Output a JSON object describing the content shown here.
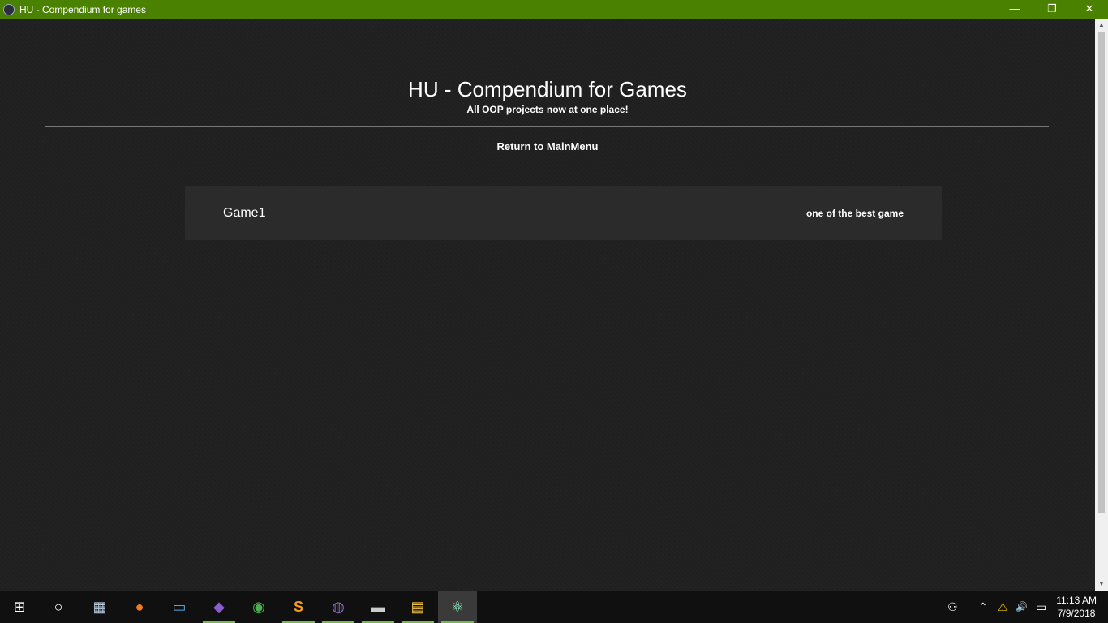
{
  "window": {
    "title": "HU - Compendium for games",
    "minimize": "—",
    "restore": "❐",
    "close": "✕"
  },
  "page": {
    "title": "HU - Compendium for Games",
    "subtitle": "All OOP projects now at one place!",
    "return_link": "Return to MainMenu"
  },
  "games": [
    {
      "name": "Game1",
      "description": "one of the best game"
    }
  ],
  "taskbar": {
    "apps": [
      {
        "name": "start",
        "icon": "⊞"
      },
      {
        "name": "cortana",
        "icon": "○"
      },
      {
        "name": "task-manager",
        "icon": "▦"
      },
      {
        "name": "firefox",
        "icon": "●"
      },
      {
        "name": "this-pc",
        "icon": "▭"
      },
      {
        "name": "visual-studio",
        "icon": "◆"
      },
      {
        "name": "chrome",
        "icon": "◉"
      },
      {
        "name": "sublime-text",
        "icon": "S"
      },
      {
        "name": "github-desktop",
        "icon": "◍"
      },
      {
        "name": "command-prompt",
        "icon": "▬"
      },
      {
        "name": "file-explorer",
        "icon": "▤"
      },
      {
        "name": "electron",
        "icon": "⚛"
      }
    ],
    "tray": {
      "people": "⚇",
      "chevron": "⌃",
      "wifi": "⚠",
      "volume": "🔊",
      "battery": "▭"
    },
    "time": "11:13 AM",
    "date": "7/9/2018"
  }
}
